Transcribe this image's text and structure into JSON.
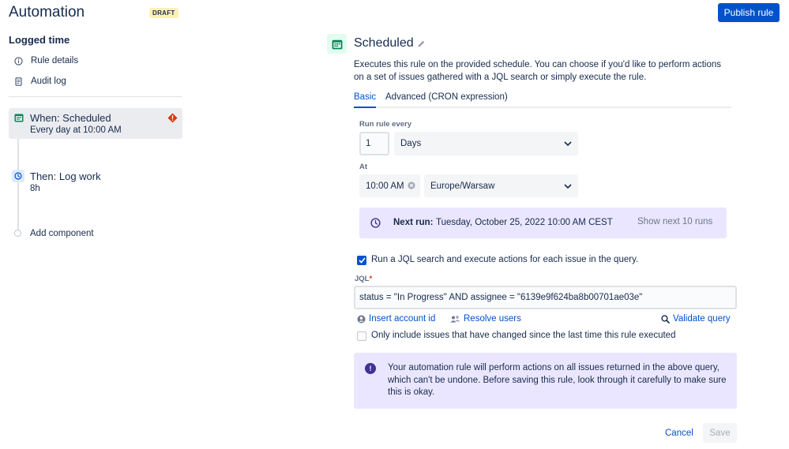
{
  "header": {
    "app_title": "Automation",
    "draft_badge": "DRAFT",
    "publish_label": "Publish rule"
  },
  "sidebar": {
    "rule_name": "Logged time",
    "links": [
      {
        "label": "Rule details",
        "icon": "info-icon"
      },
      {
        "label": "Audit log",
        "icon": "document-icon"
      }
    ],
    "trigger": {
      "title": "When: Scheduled",
      "subtitle": "Every day at 10:00 AM",
      "icon": "calendar-icon",
      "status_icon": "error-icon"
    },
    "action": {
      "title": "Then: Log work",
      "subtitle": "8h",
      "icon": "clock-icon"
    },
    "add_component": "Add component"
  },
  "main": {
    "title": "Scheduled",
    "description": "Executes this rule on the provided schedule. You can choose if you'd like to perform actions on a set of issues gathered with a JQL search or simply execute the rule.",
    "tabs": [
      {
        "label": "Basic",
        "active": true
      },
      {
        "label": "Advanced (CRON expression)",
        "active": false
      }
    ],
    "run_every": {
      "label": "Run rule every",
      "value": "1",
      "unit": "Days"
    },
    "at": {
      "label": "At",
      "time": "10:00 AM",
      "timezone": "Europe/Warsaw"
    },
    "next_run": {
      "label": "Next run:",
      "value": "Tuesday, October 25, 2022 10:00 AM CEST",
      "button": "Show next 10 runs"
    },
    "jql_checkbox": {
      "label": "Run a JQL search and execute actions for each issue in the query.",
      "checked": true
    },
    "jql": {
      "label": "JQL",
      "required_mark": "*",
      "value": "status = \"In Progress\" AND assignee = \"6139e9f624ba8b00701ae03e\""
    },
    "jql_links": {
      "insert_account": "Insert account id",
      "resolve_users": "Resolve users",
      "validate": "Validate query"
    },
    "only_changed": {
      "label": "Only include issues that have changed since the last time this rule executed",
      "checked": false
    },
    "warning": {
      "text": "Your automation rule will perform actions on all issues returned in the above query, which can't be undone. Before saving this rule, look through it carefully to make sure this is okay.",
      "icon_glyph": "!"
    },
    "footer": {
      "cancel": "Cancel",
      "save": "Save"
    }
  },
  "colors": {
    "primary": "#0052cc",
    "text": "#172b4d",
    "error": "#de350b",
    "info_bg": "#eae6ff",
    "success_bg": "#e3fcef",
    "selected_bg": "#ebecf0"
  }
}
